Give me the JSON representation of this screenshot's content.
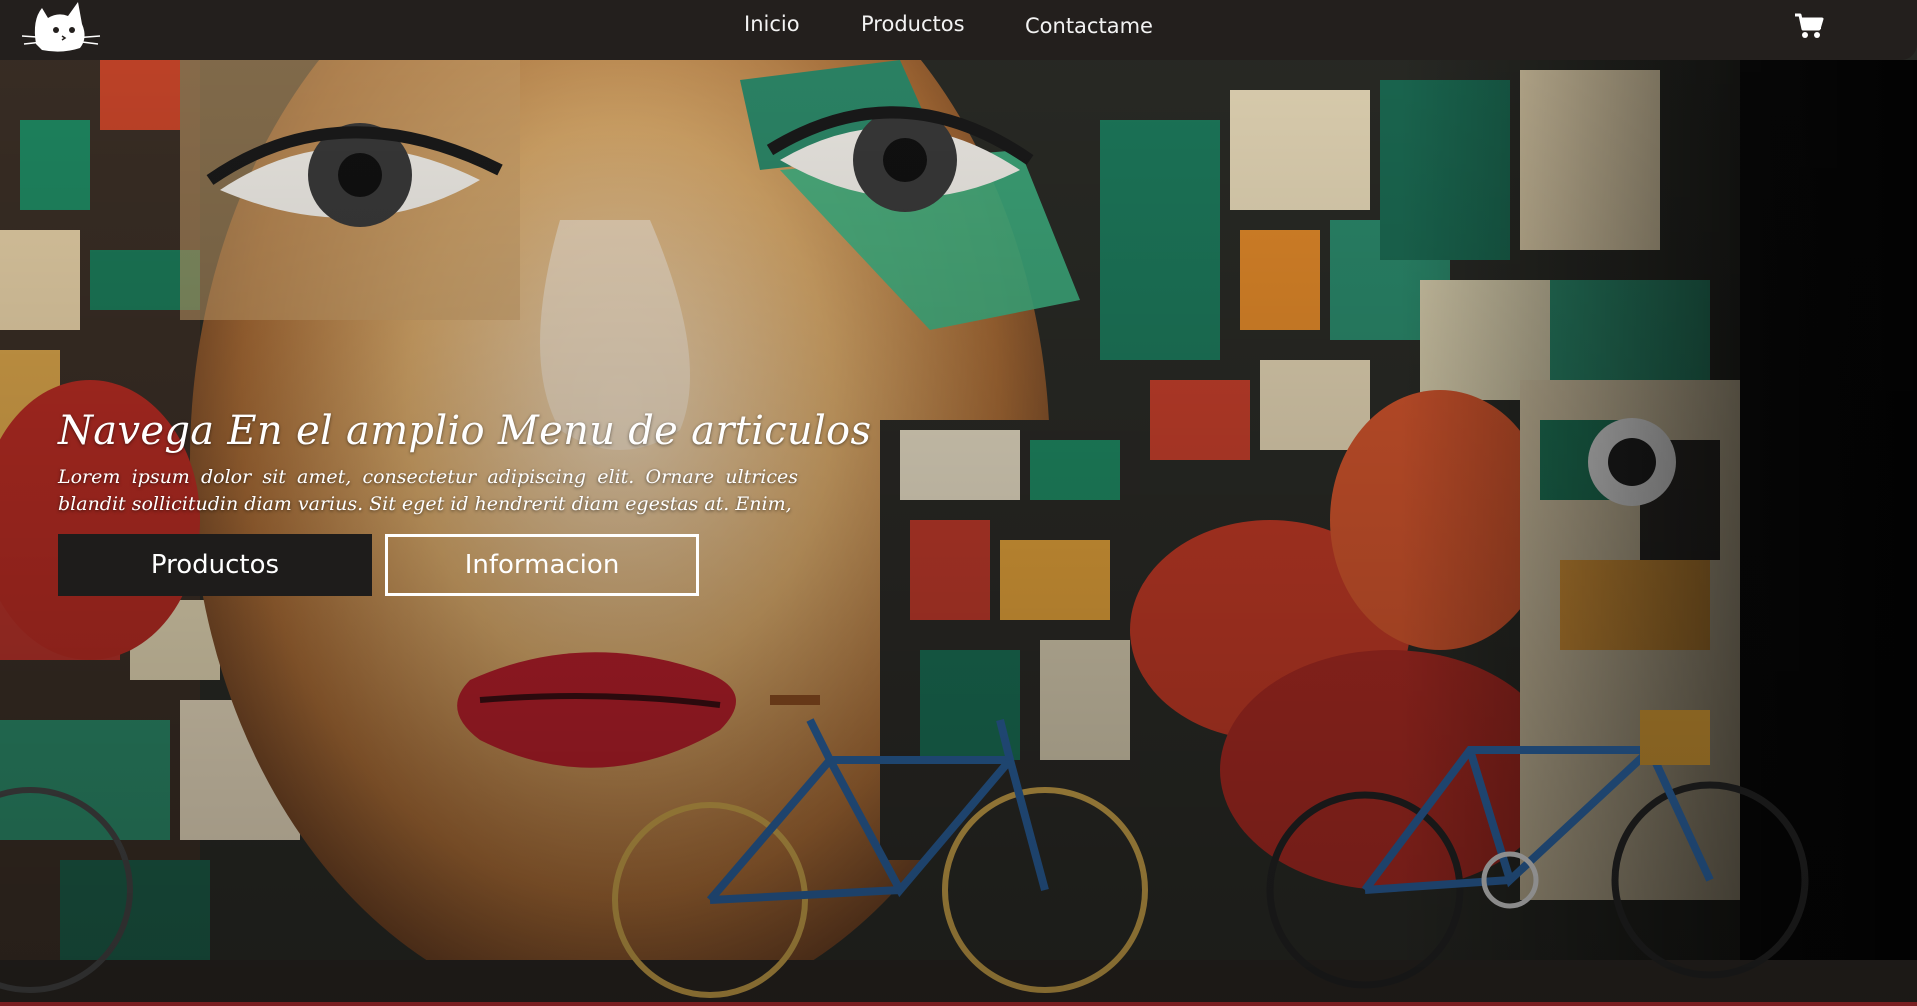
{
  "navbar": {
    "logo_icon": "cat-logo-icon",
    "links": [
      {
        "label": "Inicio"
      },
      {
        "label": "Productos"
      },
      {
        "label": "Contactame"
      }
    ],
    "cart_icon": "shopping-cart-icon",
    "background": "#231f1d"
  },
  "hero": {
    "title": "Navega En el  amplio Menu de  articulos",
    "text": "Lorem ipsum dolor sit amet, consectetur adipiscing elit. Ornare ultrices blandit sollicitudin diam varius. Sit eget id hendrerit diam egestas at. Enim,",
    "buttons": {
      "primary_label": "Productos",
      "secondary_label": "Informacion"
    },
    "image": "graffiti mural with bicycles"
  },
  "colors": {
    "accent_dark": "#1e1c1b",
    "text_light": "#ffffff"
  }
}
